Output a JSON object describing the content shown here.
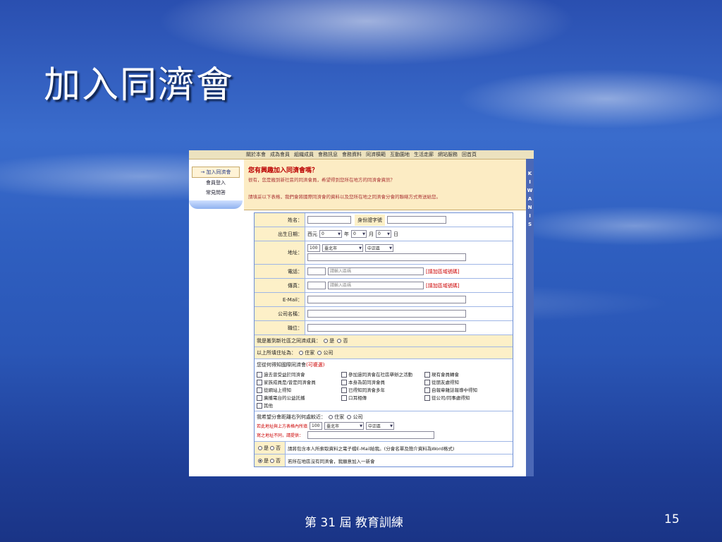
{
  "slide": {
    "title": "加入同濟會",
    "footer": "第 31 屆 教育訓練",
    "page_number": "15"
  },
  "nav": {
    "items": [
      "關於本會",
      "成為會員",
      "組織成員",
      "會務訊息",
      "會務資料",
      "同濟橫範",
      "互動園地",
      "生活走廊",
      "網站服務",
      "回首頁"
    ]
  },
  "sidebar": {
    "items": [
      "→ 加入同濟會",
      "會員登入",
      "常見問答"
    ]
  },
  "vertical_brand": [
    "K",
    "I",
    "W",
    "A",
    "N",
    "I",
    "S"
  ],
  "header": {
    "title": "您有興趣加入同濟會嗎？",
    "subtitle": "很有，您是搬到新社區的同濟會員，希望得到您所在地方的同濟會資訊？",
    "instruction": "請填妥以下表格，我們會將國際同濟會的資料以及您所在地之同濟會分會的聯絡方式寄送給您。"
  },
  "form": {
    "name_label": "姓名：",
    "id_label": "身份證字號",
    "birthday_label": "出生日期：",
    "era": "西元",
    "year_value": "0",
    "year_unit": "年",
    "month_value": "0",
    "month_unit": "月",
    "day_value": "0",
    "day_unit": "日",
    "address_label": "地址：",
    "zip": "100",
    "city": "臺北市",
    "district": "中正區",
    "phone_label": "電話：",
    "phone_placeholder": "請輸入區碼",
    "phone_note": "[請加區域號碼]",
    "fax_label": "傳真：",
    "fax_placeholder": "請輸入區碼",
    "fax_note": "[請加區域號碼]",
    "email_label": "E-Mail：",
    "company_label": "公司名稱：",
    "title_label": "職位：",
    "member_question": "我是搬到新社區之同濟成員：",
    "yes": "是",
    "no": "否",
    "address_type_question": "以上所填住址為：",
    "home": "住家",
    "company": "公司",
    "source_question": "您從何得知國際同濟會",
    "source_multi": "(可複選)",
    "sources": [
      "過去曾受益於同濟會",
      "參加過同濟會在社區舉辦之活動",
      "現有會員轉會",
      "家族成員是/曾是同濟會員",
      "本身為前同濟會員",
      "從朋友處得知",
      "從網站上得知",
      "已得知同濟會多年",
      "自報章雜誌報導中得知",
      "廣播電台的公益託播",
      "口耳相傳",
      "從公司/同事處得知",
      "其他"
    ],
    "nearest_question": "我希望分會距離右列何處較近：",
    "nearest_note1": "若此地址與上方表格內所填",
    "nearest_note2": "寫之地址不同，請提供：",
    "nearest_zip": "100",
    "nearest_city": "臺北市",
    "nearest_district": "中正區",
    "email_pref_text": "請將包含本人所索取資料之電子檔E-Mail給我。(分會名單及簡介資料為Word格式)",
    "new_club_text": "若所在地區沒有同濟會，我願意加入一新會"
  }
}
